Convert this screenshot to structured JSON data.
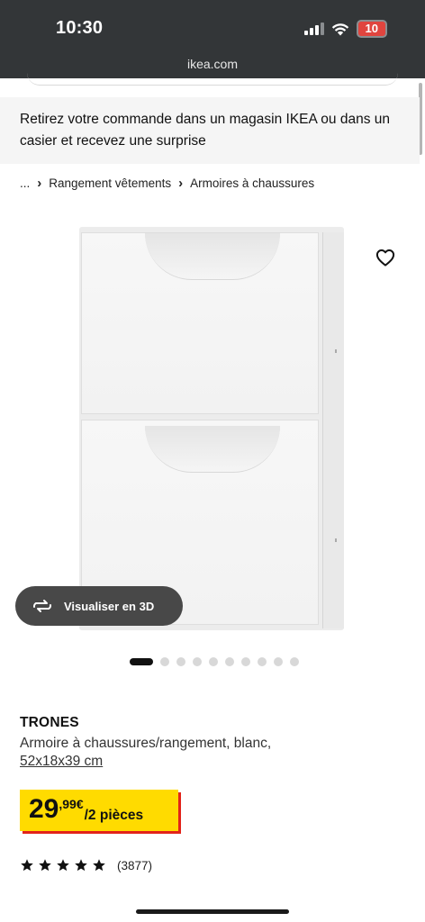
{
  "status_bar": {
    "time": "10:30",
    "battery": "10"
  },
  "browser": {
    "url": "ikea.com"
  },
  "promo_banner": {
    "text": "Retirez votre commande dans un magasin IKEA ou dans un casier et recevez une surprise"
  },
  "breadcrumb": {
    "items": [
      {
        "label": "..."
      },
      {
        "label": "Rangement vêtements"
      },
      {
        "label": "Armoires à chaussures"
      }
    ]
  },
  "gallery": {
    "icon_favorite": "heart-icon",
    "view_3d_label": "Visualiser en 3D",
    "image_count": 10,
    "active_index": 0
  },
  "product": {
    "name": "TRONES",
    "description": "Armoire à chaussures/rangement, blanc,",
    "dimensions": "52x18x39 cm",
    "price": {
      "integer": "29",
      "decimal": ",99€",
      "unit": "/2 pièces"
    },
    "rating": {
      "stars": 5,
      "count": "(3877)"
    }
  },
  "colors": {
    "price_tag": "#ffdb00",
    "price_shadow": "#e2231a",
    "topbar": "#333638"
  }
}
